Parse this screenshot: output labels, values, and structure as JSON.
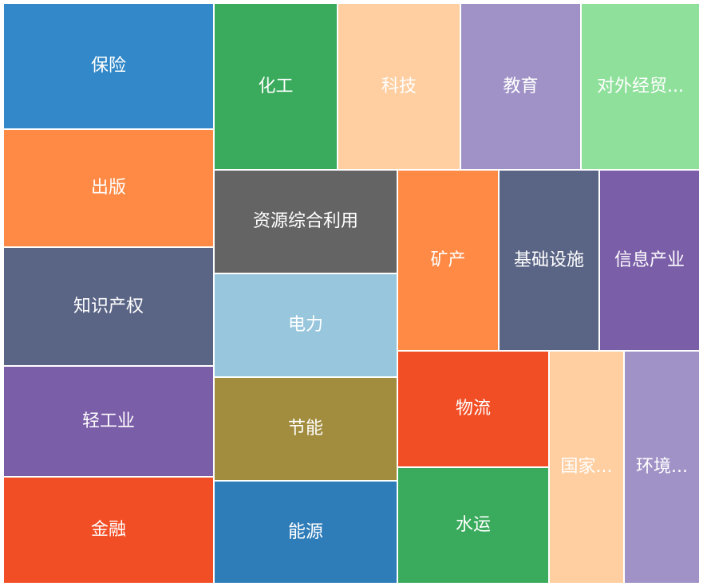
{
  "chart_data": {
    "type": "treemap",
    "items": [
      {
        "name": "保险",
        "label": "保险",
        "color": "#3288c8"
      },
      {
        "name": "出版",
        "label": "出版",
        "color": "#ff8a45"
      },
      {
        "name": "知识产权",
        "label": "知识产权",
        "color": "#5a6485"
      },
      {
        "name": "轻工业",
        "label": "轻工业",
        "color": "#7b5ea8"
      },
      {
        "name": "金融",
        "label": "金融",
        "color": "#f24e25"
      },
      {
        "name": "化工",
        "label": "化工",
        "color": "#3aab5c"
      },
      {
        "name": "科技",
        "label": "科技",
        "color": "#ffcea1"
      },
      {
        "name": "教育",
        "label": "教育",
        "color": "#a092c6"
      },
      {
        "name": "对外经贸",
        "label": "对外经贸...",
        "color": "#8fe09b"
      },
      {
        "name": "资源综合利用",
        "label": "资源综合利用",
        "color": "#646464"
      },
      {
        "name": "电力",
        "label": "电力",
        "color": "#97c6dd"
      },
      {
        "name": "节能",
        "label": "节能",
        "color": "#a28c3e"
      },
      {
        "name": "能源",
        "label": "能源",
        "color": "#2e7cb8"
      },
      {
        "name": "矿产",
        "label": "矿产",
        "color": "#ff8a45"
      },
      {
        "name": "基础设施",
        "label": "基础设施",
        "color": "#5a6485"
      },
      {
        "name": "信息产业",
        "label": "信息产业",
        "color": "#7b5ea8"
      },
      {
        "name": "物流",
        "label": "物流",
        "color": "#f24e25"
      },
      {
        "name": "水运",
        "label": "水运",
        "color": "#3aab5c"
      },
      {
        "name": "国家",
        "label": "国家...",
        "color": "#ffcea1"
      },
      {
        "name": "环境",
        "label": "环境...",
        "color": "#a092c6"
      }
    ]
  }
}
